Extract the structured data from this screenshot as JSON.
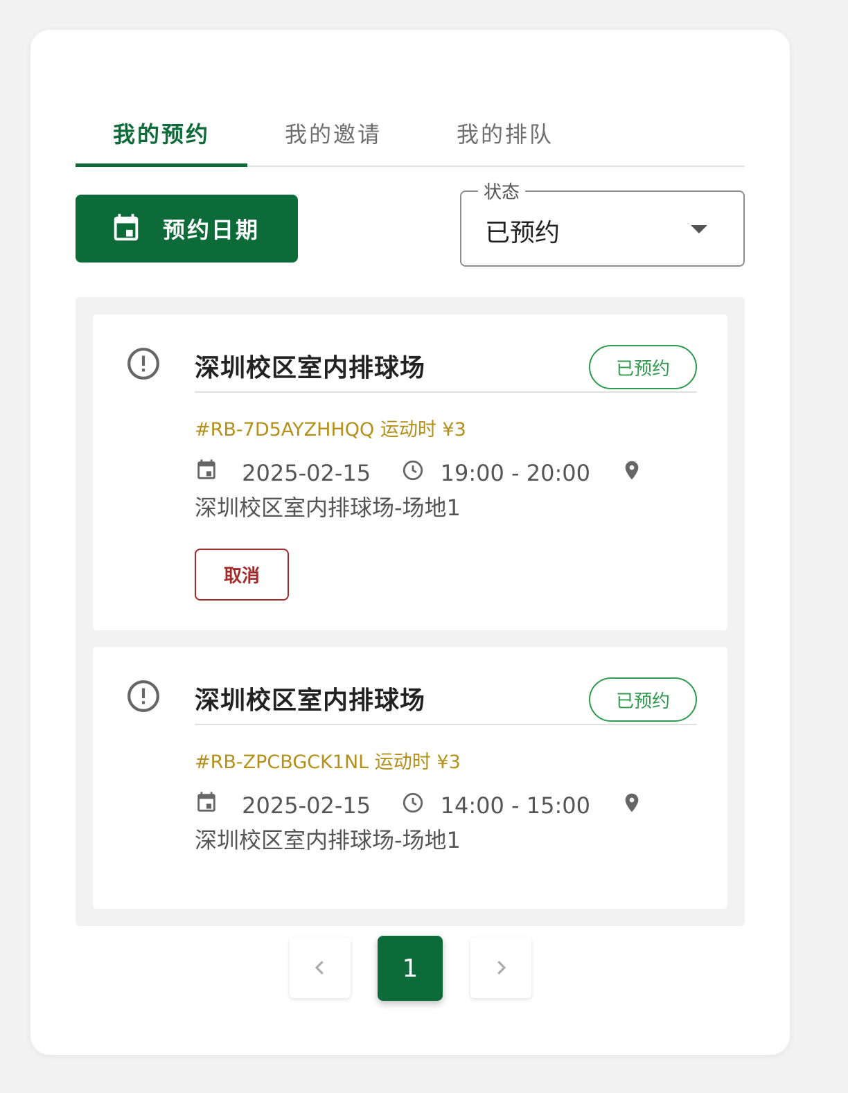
{
  "tabs": [
    {
      "label": "我的预约",
      "active": true
    },
    {
      "label": "我的邀请",
      "active": false
    },
    {
      "label": "我的排队",
      "active": false
    }
  ],
  "filters": {
    "date_button_label": "预约日期",
    "status_label": "状态",
    "status_value": "已预约"
  },
  "reservations": [
    {
      "title": "深圳校区室内排球场",
      "status": "已预约",
      "code_line": "#RB-7D5AYZHHQQ 运动时 ¥3",
      "date": "2025-02-15",
      "time": "19:00 - 20:00",
      "location": "深圳校区室内排球场-场地1",
      "cancel_label": "取消"
    },
    {
      "title": "深圳校区室内排球场",
      "status": "已预约",
      "code_line": "#RB-ZPCBGCK1NL 运动时 ¥3",
      "date": "2025-02-15",
      "time": "14:00 - 15:00",
      "location": "深圳校区室内排球场-场地1"
    }
  ],
  "pagination": {
    "current_page": "1"
  },
  "colors": {
    "primary": "#0d6b3a",
    "status_green": "#2e9a4e",
    "code_gold": "#b3901a",
    "cancel_red": "#a12b2b"
  },
  "icons": [
    "calendar-icon",
    "alert-circle-icon",
    "clock-icon",
    "map-pin-icon",
    "chevron-left-icon",
    "chevron-right-icon",
    "caret-down-icon"
  ]
}
